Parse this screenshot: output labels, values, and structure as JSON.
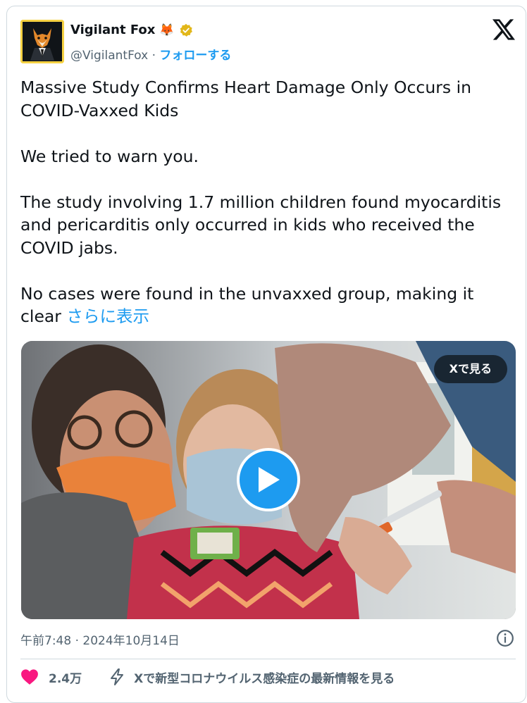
{
  "author": {
    "name": "Vigilant Fox",
    "emoji": "🦊",
    "handle": "@VigilantFox",
    "separator": "·",
    "follow_label": "フォローする",
    "verified_color": "#e2b719"
  },
  "tweet": {
    "paragraphs": [
      "Massive Study Confirms Heart Damage Only Occurs in COVID-Vaxxed Kids",
      "We tried to warn you.",
      "The study involving 1.7 million children found myocarditis and pericarditis only occurred in kids who received the COVID jabs."
    ],
    "last_paragraph": "No cases were found in the unvaxxed group, making it clear",
    "show_more": "さらに表示"
  },
  "media": {
    "watch_on_x": "Xで見る",
    "play_color": "#1d9bf0"
  },
  "meta": {
    "timestamp": "午前7:48 · 2024年10月14日"
  },
  "actions": {
    "like_count": "2.4万",
    "like_color": "#f91880",
    "covid_info": "Xで新型コロナウイルス感染症の最新情報を見る"
  },
  "icons": [
    "x-logo-icon",
    "verified-badge-icon",
    "play-icon",
    "info-icon",
    "heart-icon",
    "lightning-icon"
  ]
}
